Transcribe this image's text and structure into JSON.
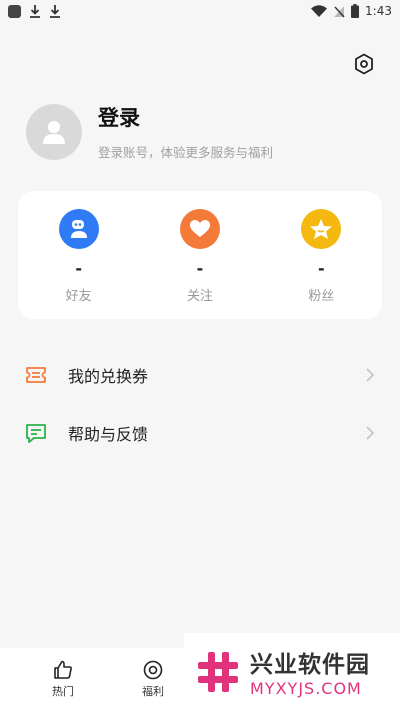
{
  "status_bar": {
    "time": "1:43",
    "icons": [
      "app-icon",
      "download-icon",
      "download-icon",
      "wifi-icon",
      "no-signal-icon",
      "battery-icon"
    ]
  },
  "header": {
    "settings_icon": "gear-hexagon-icon"
  },
  "profile": {
    "title": "登录",
    "subtitle": "登录账号，体验更多服务与福利"
  },
  "stats": [
    {
      "value": "-",
      "label": "好友",
      "color": "#2f7bf5",
      "icon": "friend-icon"
    },
    {
      "value": "-",
      "label": "关注",
      "color": "#f47a3a",
      "icon": "heart-icon"
    },
    {
      "value": "-",
      "label": "粉丝",
      "color": "#f5b80f",
      "icon": "star-icon"
    }
  ],
  "menu": [
    {
      "label": "我的兑换券",
      "icon": "ticket-icon",
      "color": "#f47a3a"
    },
    {
      "label": "帮助与反馈",
      "icon": "feedback-icon",
      "color": "#28b34a"
    }
  ],
  "bottom_nav": [
    {
      "label": "热门",
      "icon": "thumbs-up-icon"
    },
    {
      "label": "福利",
      "icon": "target-icon"
    }
  ],
  "watermark": {
    "main": "兴业软件园",
    "url": "MYXYJS.COM",
    "color": "#e0337b"
  }
}
